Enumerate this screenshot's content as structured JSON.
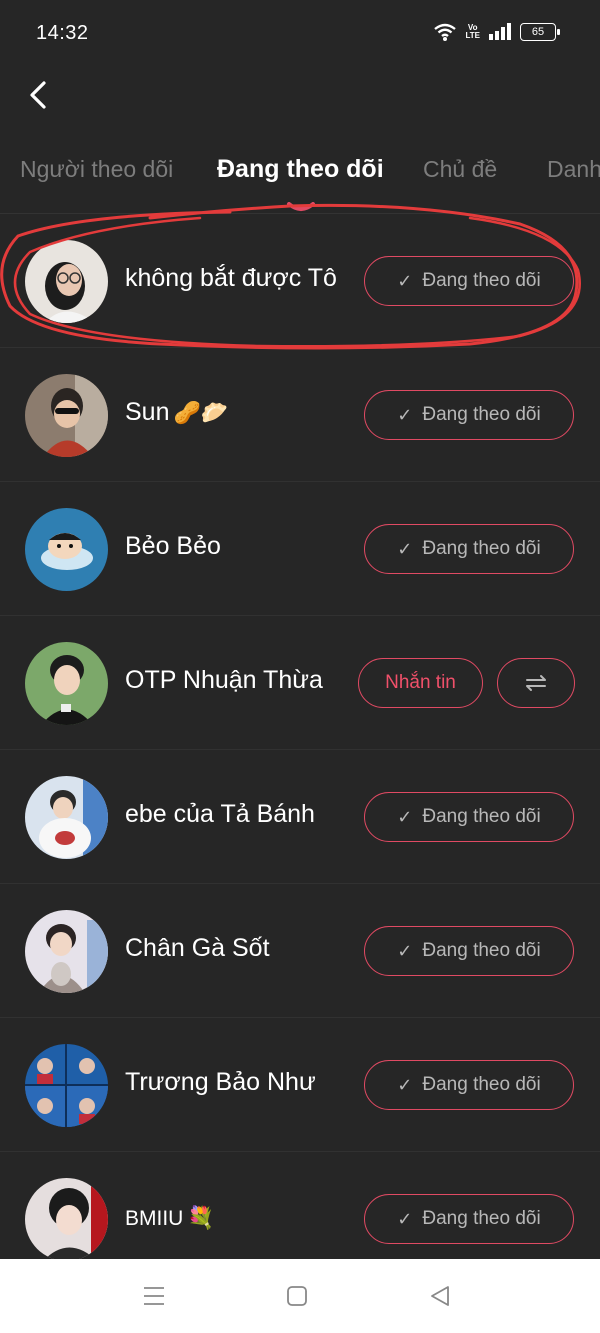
{
  "status_bar": {
    "time": "14:32",
    "battery": "65",
    "volte_top": "Vo",
    "volte_bottom": "LTE"
  },
  "tabs": [
    {
      "label": "Người theo dõi",
      "active": false
    },
    {
      "label": "Đang theo dõi",
      "active": true
    },
    {
      "label": "Chủ đề",
      "active": false
    },
    {
      "label": "Danh",
      "active": false
    }
  ],
  "following_label": "Đang theo dõi",
  "users": [
    {
      "name": "không bắt được Tô",
      "emoji": "",
      "action": "following"
    },
    {
      "name": "Sun",
      "emoji": "🥜🥟",
      "action": "following"
    },
    {
      "name": "Bẻo Bẻo",
      "emoji": "",
      "action": "following"
    },
    {
      "name": "OTP Nhuận Thừa",
      "emoji": "",
      "action": "mutual"
    },
    {
      "name": "ebe của Tả Bánh",
      "emoji": "",
      "action": "following"
    },
    {
      "name": "Chân Gà Sốt",
      "emoji": "",
      "action": "following"
    },
    {
      "name": "Trương Bảo Như",
      "emoji": "",
      "action": "following"
    },
    {
      "name": "BMIIU",
      "emoji": "💐",
      "action": "following"
    }
  ],
  "message_label": "Nhắn tin",
  "colors": {
    "background": "#262626",
    "accent": "#e04a63",
    "annotation": "#e33b3b"
  },
  "icons": {
    "back": "chevron-left-icon",
    "check": "check-icon",
    "mutual": "swap-arrows-icon"
  }
}
